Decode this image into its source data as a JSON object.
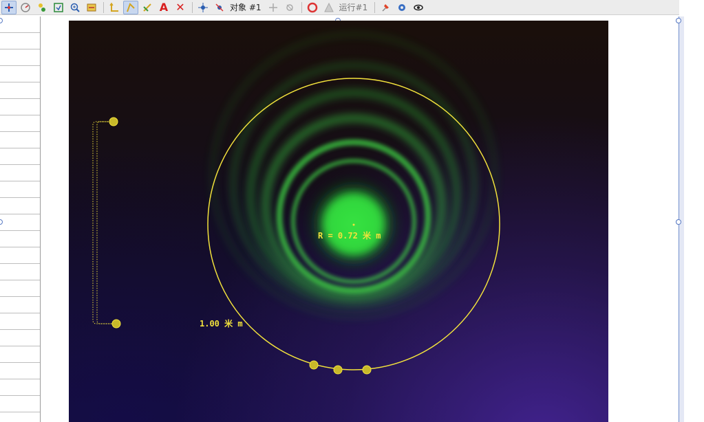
{
  "toolbar": {
    "object_label": "对象 #1",
    "run_label": "运行#1",
    "icons": [
      "axes-icon",
      "calibration-icon",
      "point-mass-icon",
      "export-icon",
      "zoom-icon",
      "tape-icon",
      "coordinate-axes-icon",
      "track-icon",
      "protractor-icon",
      "text-A-icon",
      "delete-icon",
      "new-point-icon",
      "point-delete-icon",
      "object-track-icon",
      "disabled-track-icon",
      "circle-fitter-icon",
      "disabled-shape-icon",
      "pin-icon",
      "settings-icon",
      "eye-icon"
    ]
  },
  "overlay": {
    "radius_label": "R = 0.72 米 m",
    "scale_label": "1.00 米 m",
    "circle_color": "#f2e23c"
  }
}
